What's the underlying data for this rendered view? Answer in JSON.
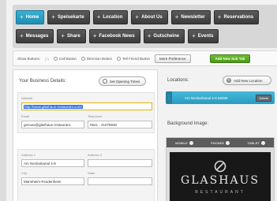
{
  "nav": {
    "row1": [
      "Home",
      "Speisekarte",
      "Location",
      "About Us",
      "Newsletter",
      "Reservations"
    ],
    "row2": [
      "Messages",
      "Share",
      "Facebook News",
      "Gutscheine",
      "Events"
    ]
  },
  "bar": {
    "show_buttons_label": "Show Buttons:",
    "options": [
      "Call Button",
      "Direction Button",
      "Tell Friend Button"
    ],
    "more_preference": "More Preference",
    "add_new_sub_tab": "Add New Sub Tab"
  },
  "details": {
    "title": "Your Business Details:",
    "set_opening_times": "Set Opening Times",
    "website_label": "Website",
    "website_value": "http://www.glashaus-restaurant.com/",
    "email_label": "Email",
    "email_value": "genuss@glashaus-restaurant.",
    "telephone_label": "Telephone",
    "telephone_value": "0621 - 41078930",
    "address1_label": "Address 1",
    "address1_value": "Am Neckarkanal 4-8",
    "address2_label": "Address 2",
    "address2_value": "",
    "city_label": "City",
    "city_value": "Mannheim-Feudenheim",
    "state_label": "State",
    "state_value": ""
  },
  "locations": {
    "title": "Locations:",
    "add_new_location": "Add New Location",
    "items": [
      "Am Neckarkanal 4-8 68259"
    ],
    "delete_label": "Delete"
  },
  "background": {
    "title": "Background Image:",
    "device_tabs": [
      "MOBILE",
      "PHONES",
      "TABLET"
    ],
    "logo_name": "GLASHAUS",
    "logo_sub": "RESTAURANT"
  },
  "colors": {
    "accent_blue": "#2a9cc0",
    "tab_dark": "#3c3c3c",
    "green": "#4a9a1a"
  }
}
